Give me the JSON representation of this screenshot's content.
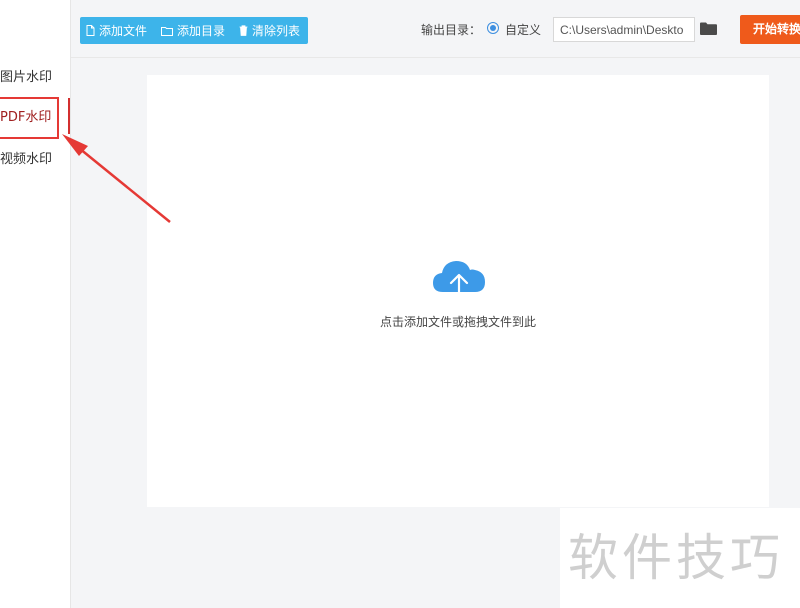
{
  "sidebar": {
    "items": [
      {
        "label": "图片水印",
        "active": false
      },
      {
        "label": "PDF水印",
        "active": true
      },
      {
        "label": "视频水印",
        "active": false
      }
    ]
  },
  "toolbar": {
    "add_file": "添加文件",
    "add_dir": "添加目录",
    "clear_list": "清除列表",
    "output_label": "输出目录：",
    "custom_option": "自定义",
    "output_path": "C:\\Users\\admin\\Deskto",
    "start_button": "开始转换"
  },
  "dropzone": {
    "hint": "点击添加文件或拖拽文件到此",
    "icon": "cloud-upload-icon"
  },
  "watermark": {
    "text": "软件技巧"
  },
  "colors": {
    "toolbar_button_bg": "#3db4ea",
    "start_button_bg": "#ef5a1b",
    "highlight": "#e53935",
    "cloud": "#3d9ae8"
  }
}
